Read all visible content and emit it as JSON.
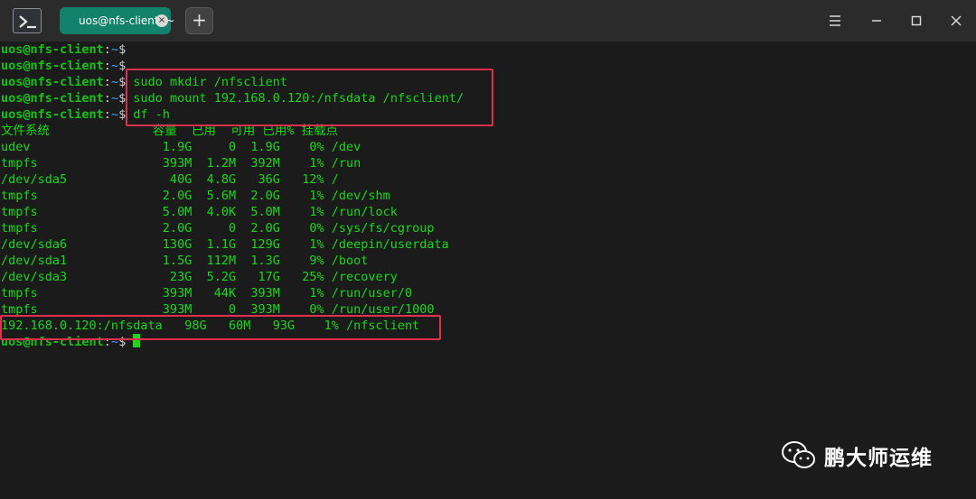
{
  "window": {
    "tab_title": "uos@nfs-client: ~",
    "tab_close": "×",
    "new_tab": "+"
  },
  "terminal": {
    "user_host": "uos@nfs-client",
    "path": "~",
    "prompt_sign": "$ ",
    "commands": [
      "",
      "",
      "sudo mkdir /nfsclient",
      "sudo mount 192.168.0.120:/nfsdata /nfsclient/",
      "df -h"
    ],
    "output": [
      "文件系统              容量  已用  可用 已用% 挂载点",
      "udev                  1.9G     0  1.9G    0% /dev",
      "tmpfs                 393M  1.2M  392M    1% /run",
      "/dev/sda5              40G  4.8G   36G   12% /",
      "tmpfs                 2.0G  5.6M  2.0G    1% /dev/shm",
      "tmpfs                 5.0M  4.0K  5.0M    1% /run/lock",
      "tmpfs                 2.0G     0  2.0G    0% /sys/fs/cgroup",
      "/dev/sda6             130G  1.1G  129G    1% /deepin/userdata",
      "/dev/sda1             1.5G  112M  1.3G    9% /boot",
      "/dev/sda3              23G  5.2G   17G   25% /recovery",
      "tmpfs                 393M   44K  393M    1% /run/user/0",
      "tmpfs                 393M     0  393M    0% /run/user/1000",
      "192.168.0.120:/nfsdata   98G   60M   93G    1% /nfsclient"
    ]
  },
  "watermark": {
    "text": "鹏大师运维",
    "icon": "wechat-icon"
  },
  "colors": {
    "terminal_bg": "#1b1b1b",
    "terminal_text": "#18d918",
    "prompt_path": "#3aa3ff",
    "highlight": "#e0304d",
    "tab_active": "#12826a"
  }
}
